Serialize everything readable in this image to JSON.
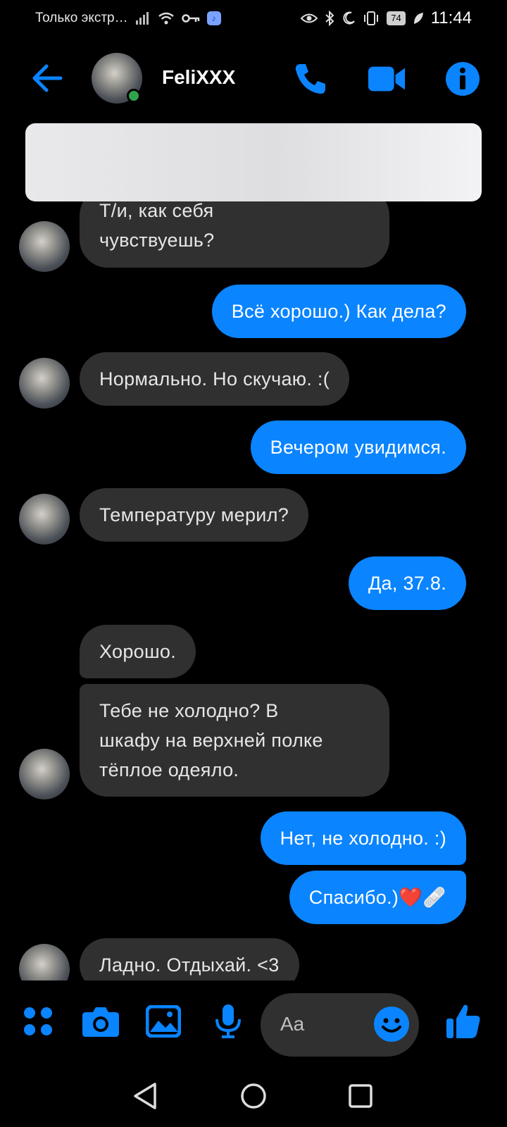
{
  "status_bar": {
    "carrier": "Только экстр…",
    "battery": "74",
    "time": "11:44"
  },
  "header": {
    "contact_name": "FeliXXX"
  },
  "messages": [
    {
      "dir": "in",
      "text": "Т/и, как себя\nчувствуешь?"
    },
    {
      "dir": "out",
      "text": "Всё хорошо.) Как дела?"
    },
    {
      "dir": "in",
      "text": "Нормально. Но скучаю. :("
    },
    {
      "dir": "out",
      "text": "Вечером увидимся."
    },
    {
      "dir": "in",
      "text": "Температуру мерил?"
    },
    {
      "dir": "out",
      "text": "Да, 37.8."
    },
    {
      "dir": "in",
      "text": "Хорошо."
    },
    {
      "dir": "in",
      "text": "Тебе не холодно? В\nшкафу на верхней полке\nтёплое одеяло."
    },
    {
      "dir": "out",
      "text": "Нет, не холодно. :)"
    },
    {
      "dir": "out",
      "text": "Спасибо.)❤️🩹"
    },
    {
      "dir": "in",
      "text": "Ладно. Отдыхай. <3"
    }
  ],
  "composer": {
    "placeholder": "Aa"
  },
  "colors": {
    "accent": "#0a84ff",
    "incoming_bubble": "#303030",
    "background": "#000000",
    "online": "#31a24c"
  },
  "icons": {
    "back": "arrow-left-icon",
    "call": "phone-icon",
    "video": "video-camera-icon",
    "info": "info-icon",
    "menu": "four-dots-icon",
    "camera": "camera-icon",
    "gallery": "image-icon",
    "mic": "microphone-icon",
    "emoji": "smiley-icon",
    "like": "thumbs-up-icon"
  }
}
